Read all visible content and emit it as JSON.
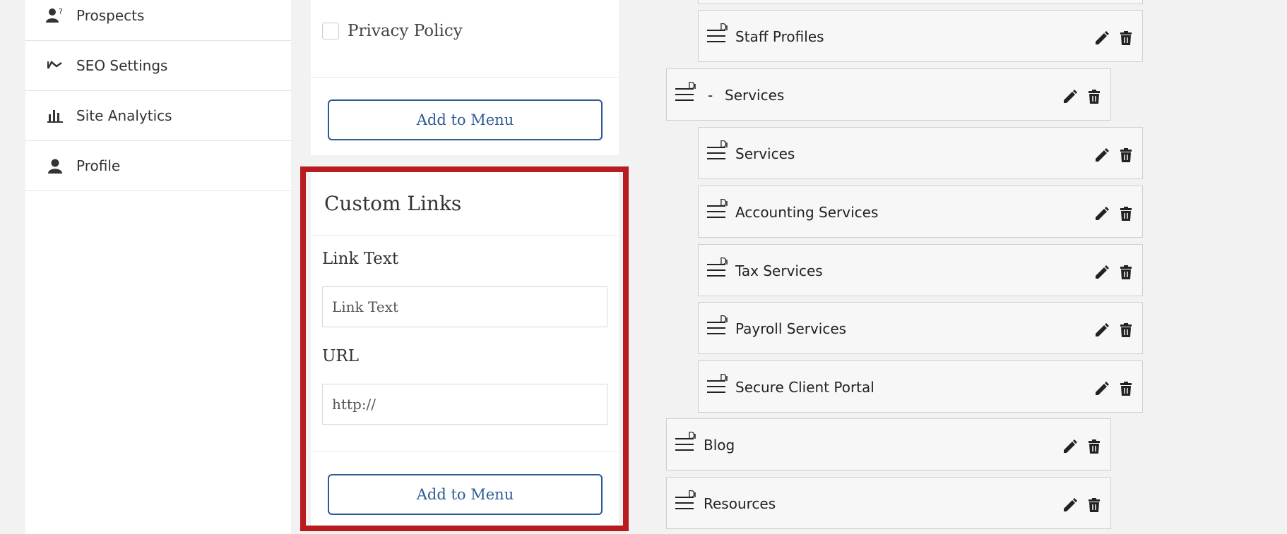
{
  "sidebar": {
    "items": [
      {
        "label": "Prospects",
        "icon": "user-question-icon"
      },
      {
        "label": "SEO Settings",
        "icon": "trend-line-icon"
      },
      {
        "label": "Site Analytics",
        "icon": "bar-chart-icon"
      },
      {
        "label": "Profile",
        "icon": "user-icon"
      }
    ]
  },
  "pages_panel": {
    "privacy_label": "Privacy Policy",
    "add_button": "Add to Menu"
  },
  "custom_links": {
    "title": "Custom Links",
    "link_text_label": "Link Text",
    "link_text_placeholder": "Link Text",
    "url_label": "URL",
    "url_value": "http://",
    "add_button": "Add to Menu"
  },
  "menu": {
    "items": [
      {
        "label": "Staff Profiles",
        "level": 2
      },
      {
        "label": "Services",
        "prefix": "-",
        "level": 1
      },
      {
        "label": "Services",
        "level": 2
      },
      {
        "label": "Accounting Services",
        "level": 2
      },
      {
        "label": "Tax Services",
        "level": 2
      },
      {
        "label": "Payroll Services",
        "level": 2
      },
      {
        "label": "Secure Client Portal",
        "level": 2
      },
      {
        "label": "Blog",
        "level": 1
      },
      {
        "label": "Resources",
        "level": 1
      }
    ]
  },
  "colors": {
    "accent": "#2b5a94",
    "highlight": "#b81c20"
  }
}
